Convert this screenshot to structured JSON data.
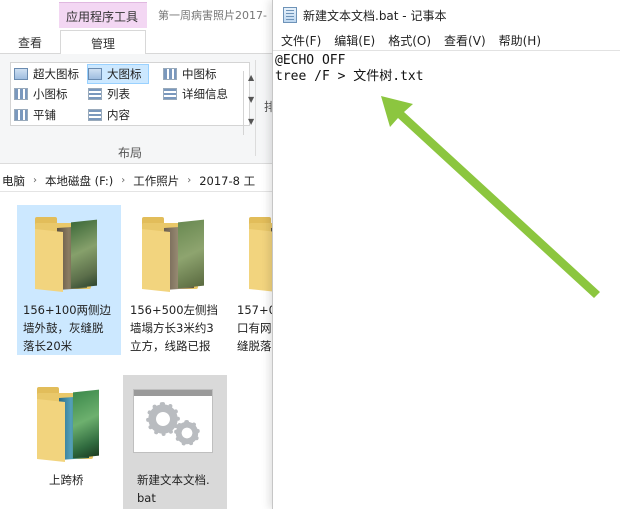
{
  "explorer": {
    "context_tab": "应用程序工具",
    "window_title": "第一周病害照片2017-",
    "tabs": {
      "view": "查看",
      "manage": "管理"
    },
    "layout_options": [
      {
        "label": "超大图标",
        "icon": "extra-large-icons-icon"
      },
      {
        "label": "大图标",
        "icon": "large-icons-icon",
        "selected": true
      },
      {
        "label": "中图标",
        "icon": "medium-icons-icon"
      },
      {
        "label": "小图标",
        "icon": "small-icons-icon"
      },
      {
        "label": "列表",
        "icon": "list-icon"
      },
      {
        "label": "详细信息",
        "icon": "details-icon"
      },
      {
        "label": "平铺",
        "icon": "tiles-icon"
      },
      {
        "label": "内容",
        "icon": "content-icon"
      }
    ],
    "layout_group_label": "布局",
    "ribbon_cut_label": "排",
    "breadcrumb": [
      "电脑",
      "本地磁盘 (F:)",
      "工作照片",
      "2017-8 工"
    ],
    "files": [
      {
        "name_lines": [
          "156+100两侧边",
          "墙外鼓，灰缝脱",
          "落长20米"
        ],
        "type": "folder",
        "selected": true
      },
      {
        "name_lines": [
          "156+500左侧挡",
          "墙塌方长3米约3",
          "立方，线路已报"
        ],
        "type": "folder"
      },
      {
        "name_lines": [
          "157+0",
          "口有网",
          "缝脱落"
        ],
        "type": "folder"
      },
      {
        "name_lines": [
          "上跨桥"
        ],
        "type": "folder"
      },
      {
        "name_lines": [
          "新建文本文档.",
          "bat"
        ],
        "type": "bat",
        "hover": true
      }
    ]
  },
  "notepad": {
    "title": "新建文本文档.bat - 记事本",
    "menu": [
      "文件(F)",
      "编辑(E)",
      "格式(O)",
      "查看(V)",
      "帮助(H)"
    ],
    "content_lines": [
      "@ECHO OFF",
      "tree /F > 文件树.txt"
    ]
  },
  "colors": {
    "arrow": "#8cc63f",
    "selection": "#cce8ff",
    "context_tab": "#f3d7f3"
  }
}
